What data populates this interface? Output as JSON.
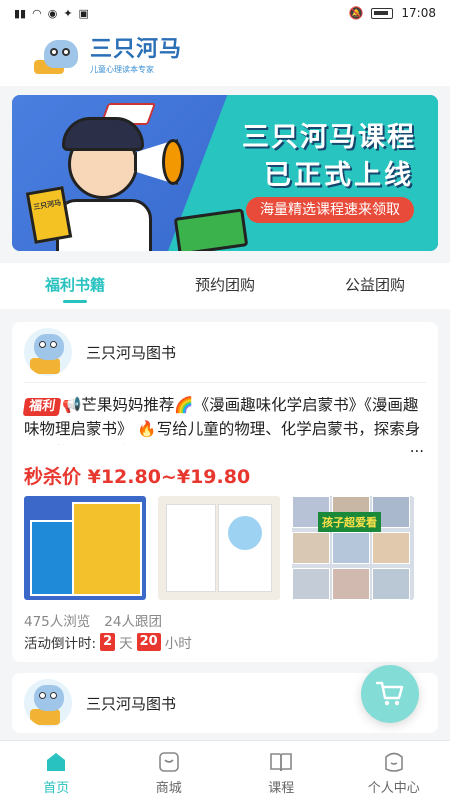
{
  "status_bar": {
    "time": "17:08"
  },
  "header": {
    "logo_title": "三只河马",
    "logo_subtitle": "儿童心理读本专家"
  },
  "banner": {
    "line1": "三只河马课程",
    "line2": "已正式上线",
    "pill": "海量精选课程速来领取",
    "book_label": "三只河马"
  },
  "tabs": [
    {
      "label": "福利书籍",
      "active": true
    },
    {
      "label": "预约团购",
      "active": false
    },
    {
      "label": "公益团购",
      "active": false
    }
  ],
  "posts": [
    {
      "shop_name": "三只河马图书",
      "badge": "福利",
      "text": "📢芒果妈妈推荐🌈《漫画趣味化学启蒙书》《漫画趣味物理启蒙书》 🔥写给儿童的物理、化学启蒙书，探索身边的物理、化学知识！",
      "ellipsis": "...",
      "price": "秒杀价 ¥12.80~¥19.80",
      "thumb3_label": "孩子超爱看",
      "views": "475人浏览",
      "followers": "24人跟团",
      "countdown_label": "活动倒计时:",
      "countdown_days": "2",
      "countdown_day_unit": "天",
      "countdown_hours": "20",
      "countdown_hour_unit": "小时"
    },
    {
      "shop_name": "三只河马图书"
    }
  ],
  "tabbar": [
    {
      "label": "首页",
      "icon": "home-icon",
      "active": true
    },
    {
      "label": "商城",
      "icon": "shop-icon",
      "active": false
    },
    {
      "label": "课程",
      "icon": "book-icon",
      "active": false
    },
    {
      "label": "个人中心",
      "icon": "profile-icon",
      "active": false
    }
  ],
  "colors": {
    "accent": "#28c2c0",
    "price_red": "#e8372f",
    "banner_blue": "#3a6fcf",
    "banner_teal": "#28c5c0"
  }
}
